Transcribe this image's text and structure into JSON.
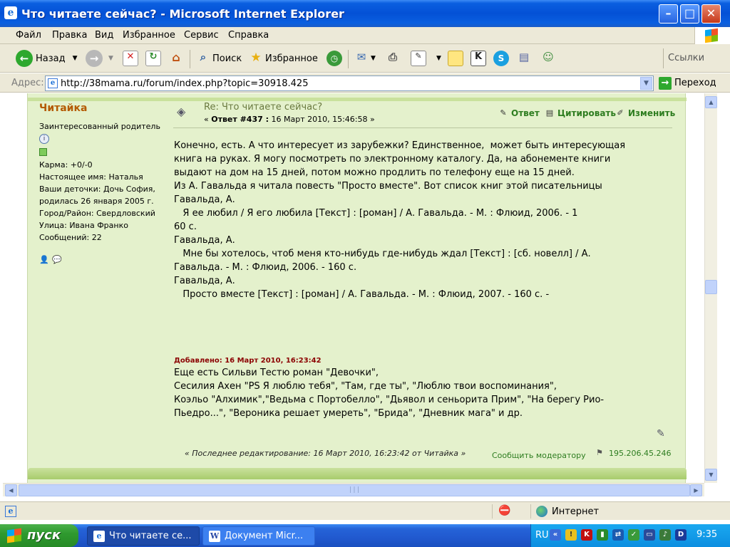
{
  "window": {
    "title": "Что читаете сейчас? - Microsoft Internet Explorer"
  },
  "menu": [
    "Файл",
    "Правка",
    "Вид",
    "Избранное",
    "Сервис",
    "Справка"
  ],
  "toolbar": {
    "back_label": "Назад",
    "search_label": "Поиск",
    "favorites_label": "Избранное",
    "links_label": "Ссылки"
  },
  "address": {
    "label": "Адрес:",
    "url": "http://38mama.ru/forum/index.php?topic=30918.425",
    "go_label": "Переход"
  },
  "post": {
    "author": "Читайка",
    "author_title": "Заинтересованный родитель",
    "author_details": [
      "Карма: +0/-0",
      "Настоящее имя: Наталья",
      "Ваши деточки: Дочь София,",
      "родилась 26 января 2005 г.",
      "Город/Район: Свердловский",
      "Улица: Ивана Франко",
      "Сообщений: 22"
    ],
    "subject": "Re: Что читаете сейчас?",
    "meta_prefix": "« ",
    "meta_number": "Ответ #437 :",
    "meta_date": " 16 Март 2010, 15:46:58 »",
    "actions": {
      "reply": "Ответ",
      "quote": "Цитировать",
      "edit": "Изменить"
    },
    "body": "Конечно, есть. А что интересует из зарубежки? Единственное,  может быть интересующая\nкнига на руках. Я могу посмотреть по электронному каталогу. Да, на абонементе книги\nвыдают на дом на 15 дней, потом можно продлить по телефону еще на 15 дней.\nИз А. Гавальда я читала повесть \"Просто вместе\". Вот список книг этой писательницы\nГавальда, А.\n   Я ее любил / Я его любила [Текст] : [роман] / А. Гавальда. - М. : Флюид, 2006. - 1\n60 с.\nГавальда, А.\n   Мне бы хотелось, чтоб меня кто-нибудь где-нибудь ждал [Текст] : [сб. новелл] / А.\nГавальда. - М. : Флюид, 2006. - 160 с.\nГавальда, А.\n   Просто вместе [Текст] : [роман] / А. Гавальда. - М. : Флюид, 2007. - 160 с. -",
    "added_label": "Добавлено: 16 Март 2010, 16:23:42",
    "body2": "Еще есть Сильви Тестю роман \"Девочки\",\nСесилия Ахен \"PS Я люблю тебя\", \"Там, где ты\", \"Люблю твои воспоминания\",\nКоэльо \"Алхимик\",\"Ведьма с Портобелло\", \"Дьявол и сеньорита Прим\", \"На берегу Рио-\nПьедро...\", \"Вероника решает умереть\", \"Брида\", \"Дневник мага\" и др.",
    "last_edit": "« Последнее редактирование: 16 Март 2010, 16:23:42 от Читайка »",
    "report": "Сообщить модератору",
    "ip": "195.206.45.246"
  },
  "status": {
    "zone": "Интернет"
  },
  "taskbar": {
    "start": "пуск",
    "tasks": [
      "Что читаете се...",
      "Документ Micr..."
    ],
    "lang": "RU",
    "clock": "9:35"
  },
  "colors": {
    "forum_bg": "#e4f1cc",
    "author": "#b45a00",
    "link_green": "#2e7d20",
    "added_red": "#8b0000",
    "xp_blue": "#0451d6"
  }
}
